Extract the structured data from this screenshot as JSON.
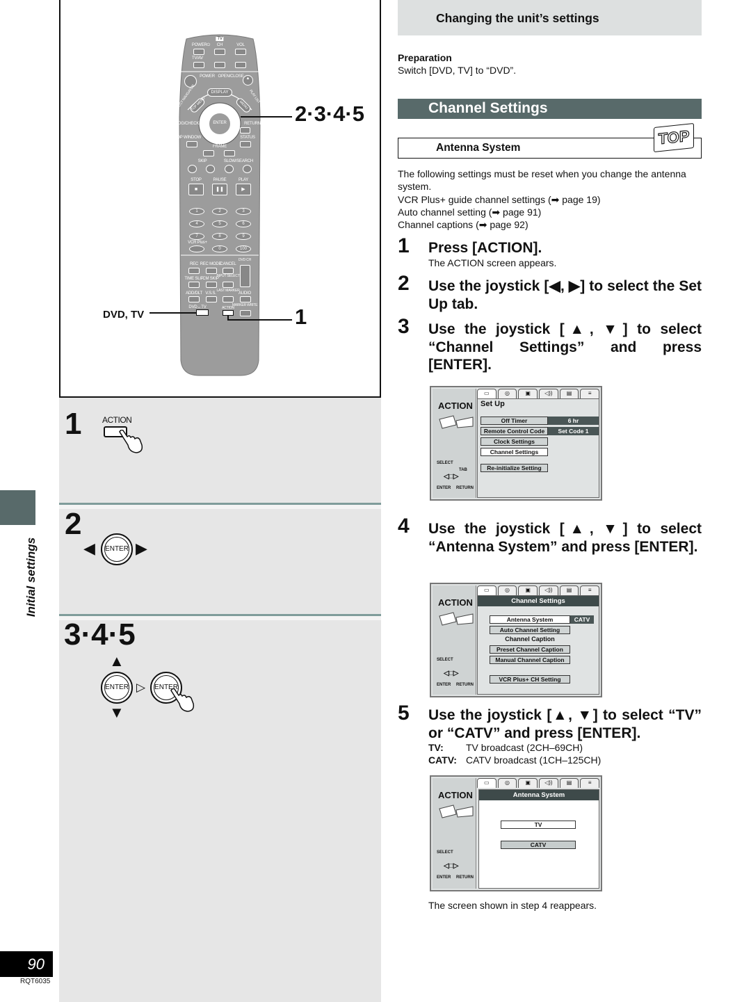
{
  "remote": {
    "labels": {
      "tv": "TV",
      "power_tv": "POWER⏻",
      "ch": "CH",
      "vol": "VOL",
      "tvav": "TV/AV",
      "power": "POWER",
      "open_close": "OPEN/CLOSE",
      "display": "DISPLAY",
      "direct_nav": "DIRECT NAVIGATOR",
      "play_list": "PLAY LIST",
      "top_menu": "TOP MENU",
      "menu": "MENU",
      "enter": "ENTER",
      "prog_check": "PROG/CHECK",
      "return": "RETURN",
      "top_window": "TOP WINDOW",
      "status": "STATUS",
      "frame": "FRAME",
      "skip": "SKIP",
      "slow_search": "SLOW/SEARCH",
      "stop": "STOP",
      "pause": "PAUSE",
      "play": "PLAY",
      "vcr_plus": "VCR Plus+",
      "rec": "REC",
      "rec_mode": "REC MODE",
      "cancel": "CANCEL",
      "dvd_ch": "DVD CH",
      "time_slip": "TIME SLIP",
      "cm_skip": "CM SKIP",
      "input_select": "INPUT SELECT",
      "add_dlt": "ADD/DLT",
      "vss": "V.S.S.",
      "last_marker": "LAST MARKER",
      "audio": "AUDIO",
      "dvd_tv_switch": "DVD↔TV",
      "action": "ACTION",
      "marker_write": "MARKER WRITE"
    },
    "numbers": [
      "1",
      "2",
      "3",
      "4",
      "5",
      "6",
      "7",
      "8",
      "9",
      "0",
      "100"
    ],
    "callout_steps": "2·3·4·5",
    "callout_action": "1",
    "callout_switch": "DVD, TV"
  },
  "left_steps": [
    {
      "number": "1",
      "button_label": "ACTION"
    },
    {
      "number": "2",
      "button_label": "ENTER"
    },
    {
      "number": "3·4·5",
      "button_label": "ENTER"
    }
  ],
  "sidebar": {
    "section_label": "Initial settings",
    "page_number": "90",
    "doc_code": "RQT6035"
  },
  "header": {
    "title": "Changing the unit’s settings"
  },
  "preparation": {
    "heading": "Preparation",
    "text": "Switch [DVD, TV] to “DVD”."
  },
  "section_title": "Channel Settings",
  "subsection": {
    "title": "Antenna System",
    "badge": "TOP"
  },
  "intro": {
    "lines": [
      "The following settings must be reset when you change the antenna system.",
      "VCR Plus+ guide channel settings (➡ page 19)",
      "Auto channel setting (➡ page 91)",
      "Channel captions (➡ page 92)"
    ]
  },
  "steps": [
    {
      "number": "1",
      "text": "Press [ACTION].",
      "note": "The ACTION screen appears."
    },
    {
      "number": "2",
      "text": "Use the joystick [◀, ▶] to select the Set Up tab."
    },
    {
      "number": "3",
      "text": "Use the joystick [▲, ▼] to select “Channel Settings” and press [ENTER]."
    },
    {
      "number": "4",
      "text": "Use the joystick [▲, ▼] to select “Antenna System” and press [ENTER]."
    },
    {
      "number": "5",
      "text": "Use the joystick [▲, ▼] to select “TV” or “CATV” and press [ENTER].",
      "options": [
        {
          "label": "TV:",
          "desc": "TV broadcast (2CH–69CH)"
        },
        {
          "label": "CATV:",
          "desc": "CATV broadcast (1CH–125CH)"
        }
      ],
      "note": "The screen shown in step 4 reappears."
    }
  ],
  "osd_common": {
    "action": "ACTION",
    "select": "SELECT",
    "tab": "TAB",
    "enter": "ENTER",
    "return": "RETURN"
  },
  "screens": {
    "setup": {
      "title": "Set Up",
      "items": [
        {
          "label": "Off Timer",
          "value": "6 hr"
        },
        {
          "label": "Remote Control Code",
          "value": "Set Code 1"
        },
        {
          "label": "Clock Settings"
        },
        {
          "label": "Channel Settings",
          "selected": true
        },
        {
          "label": "Re-initialize Setting"
        }
      ]
    },
    "channel": {
      "title": "Channel Settings",
      "items": [
        {
          "label": "Antenna System",
          "value": "CATV",
          "selected": true
        },
        {
          "label": "Auto Channel Setting"
        },
        {
          "label": "Channel Caption"
        },
        {
          "label": "Preset Channel Caption"
        },
        {
          "label": "Manual Channel Caption"
        },
        {
          "label": "VCR Plus+ CH Setting"
        }
      ]
    },
    "antenna": {
      "title": "Antenna System",
      "items": [
        {
          "label": "TV",
          "selected": true
        },
        {
          "label": "CATV"
        }
      ]
    }
  },
  "colors": {
    "accent_bar": "#586a6a",
    "header_bg": "#dde0e0",
    "panel_bg": "#e6e6e6",
    "separator": "#7f9c9a"
  }
}
